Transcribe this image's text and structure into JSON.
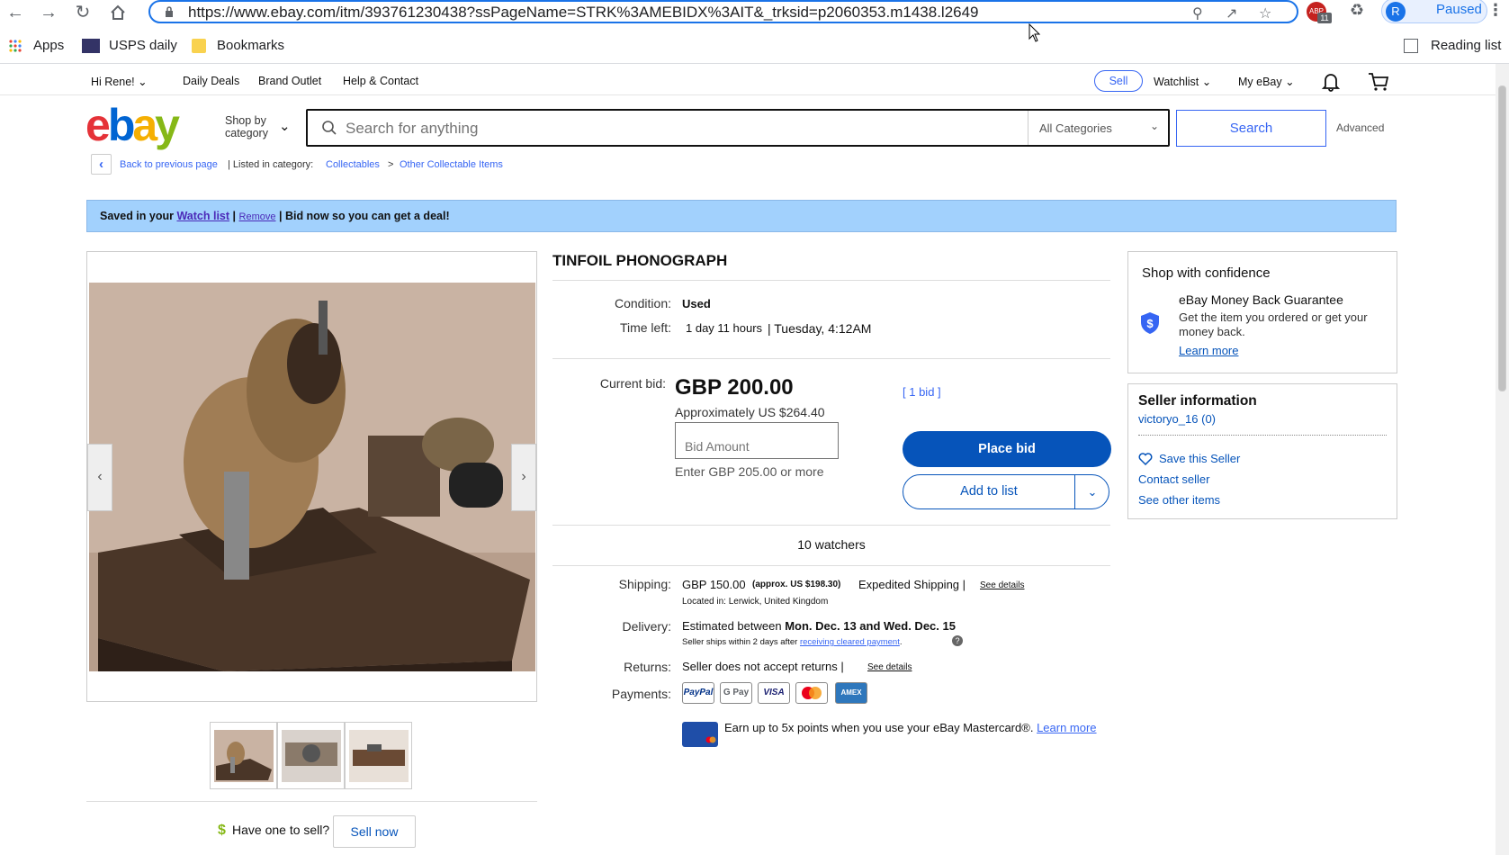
{
  "browser": {
    "url": "https://www.ebay.com/itm/393761230438?ssPageName=STRK%3AMEBIDX%3AIT&_trksid=p2060353.m1438.l2649",
    "profile_initial": "R",
    "profile_status": "Paused",
    "extension_badge": "11",
    "bookmarks": [
      "Apps",
      "USPS daily",
      "Bookmarks"
    ],
    "reading_list": "Reading list"
  },
  "header": {
    "greeting": "Hi Rene!",
    "links": [
      "Daily Deals",
      "Brand Outlet",
      "Help & Contact"
    ],
    "sell": "Sell",
    "watchlist": "Watchlist",
    "my_ebay": "My eBay"
  },
  "search": {
    "shop_by_line1": "Shop by",
    "shop_by_line2": "category",
    "placeholder": "Search for anything",
    "category": "All Categories",
    "button": "Search",
    "advanced": "Advanced"
  },
  "breadcrumb": {
    "back": "Back to previous page",
    "listed_in": "| Listed in category:",
    "items": [
      "Collectables",
      "Other Collectable Items"
    ]
  },
  "banner": {
    "prefix": "Saved in your",
    "watch_list": "Watch list",
    "sep1": "|",
    "remove": "Remove",
    "suffix": "| Bid now so you can get a deal!"
  },
  "item": {
    "title": "TINFOIL PHONOGRAPH",
    "condition_label": "Condition:",
    "condition": "Used",
    "time_left_label": "Time left:",
    "time_left": "1 day 11 hours",
    "end_time": "| Tuesday, 4:12AM",
    "current_bid_label": "Current bid:",
    "price": "GBP 200.00",
    "approx": "Approximately US $264.40",
    "bid_placeholder": "Bid Amount",
    "bid_hint": "Enter GBP 205.00 or more",
    "bid_count": "1 bid",
    "place_bid": "Place bid",
    "add_to_list": "Add to list",
    "watchers": "10 watchers"
  },
  "shipping": {
    "label": "Shipping:",
    "price": "GBP 150.00",
    "approx": "(approx. US $198.30)",
    "method": "Expedited Shipping |",
    "see_details": "See details",
    "location": "Located in:  Lerwick, United Kingdom",
    "delivery_label": "Delivery:",
    "delivery_prefix": "Estimated between",
    "delivery_dates": "Mon. Dec. 13 and Wed. Dec. 15",
    "delivery_note": "Seller ships within 2 days after",
    "delivery_link": "receiving cleared payment",
    "returns_label": "Returns:",
    "returns": "Seller does not accept returns |",
    "returns_details": "See details",
    "payments_label": "Payments:",
    "payment_methods": [
      "PayPal",
      "G Pay",
      "VISA",
      "Mastercard",
      "AmEx"
    ],
    "promo": "Earn up to 5x points when you use your eBay Mastercard®.",
    "promo_link": "Learn more"
  },
  "confidence": {
    "title": "Shop with confidence",
    "guarantee": "eBay Money Back Guarantee",
    "desc": "Get the item you ordered or get your money back.",
    "learn_more": "Learn more"
  },
  "seller": {
    "title": "Seller information",
    "name": "victoryo_16",
    "feedback": "(0)",
    "save": "Save this Seller",
    "contact": "Contact seller",
    "other_items": "See other items"
  },
  "sell_prompt": {
    "question": "Have one to sell?",
    "button": "Sell now"
  },
  "colors": {
    "ebay_blue": "#3665f3",
    "banner_bg": "#a2d1fd",
    "button_blue": "#0654ba"
  }
}
